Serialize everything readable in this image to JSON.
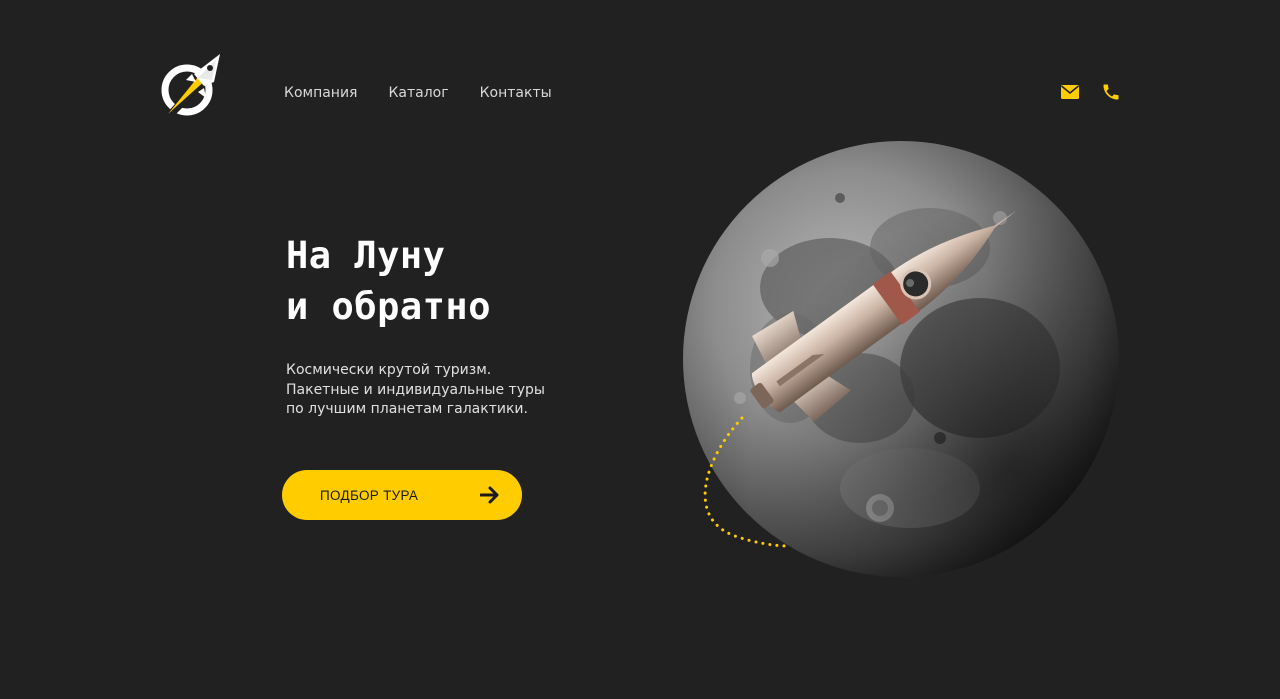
{
  "header": {
    "nav": [
      {
        "label": "Компания"
      },
      {
        "label": "Каталог"
      },
      {
        "label": "Контакты"
      }
    ],
    "icons": {
      "logo": "rocket-logo-icon",
      "mail": "mail-icon",
      "phone": "phone-icon"
    }
  },
  "hero": {
    "title_lines": [
      "На Луну",
      "и обратно"
    ],
    "description_lines": [
      "Космически крутой туризм.",
      "Пакетные и индивидуальные туры",
      "по лучшим планетам галактики."
    ],
    "cta_label": "ПОДБОР ТУРА",
    "cta_icon": "arrow-right-icon",
    "image": "moon-with-rocket"
  },
  "colors": {
    "background": "#212121",
    "accent": "#ffcc00",
    "text": "#ffffff",
    "nav_text": "#d8d8d8"
  }
}
